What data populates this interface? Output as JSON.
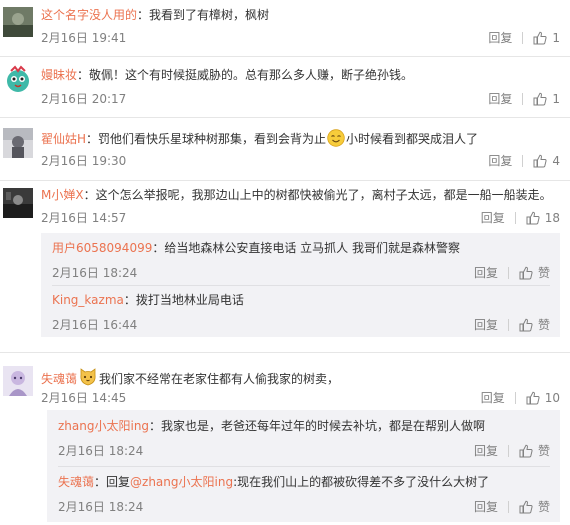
{
  "comments": [
    {
      "username": "这个名字没人用的",
      "text": "：我看到了有樟树，枫树",
      "date": "2月16日 19:41",
      "reply_label": "回复",
      "likes": "1"
    },
    {
      "username": "嫚昧妆",
      "text": "：敬佩！这个有时候挺威胁的。总有那么多人赚，断子绝孙钱。",
      "date": "2月16日 20:17",
      "reply_label": "回复",
      "likes": "1"
    },
    {
      "username": "翟仙姑H",
      "text_before": "：罚他们看快乐星球种树那集，看到会背为止",
      "text_after": "小时候看到都哭成泪人了",
      "date": "2月16日 19:30",
      "reply_label": "回复",
      "likes": "4"
    },
    {
      "username": "M小婵X",
      "text": "：这个怎么举报呢，我那边山上中的树都快被偷光了，离村子太远，都是一船一船装走。",
      "date": "2月16日 14:57",
      "reply_label": "回复",
      "likes": "18",
      "replies": [
        {
          "username": "用户6058094099",
          "text": "：给当地森林公安直接电话 立马抓人 我哥们就是森林警察",
          "date": "2月16日 18:24",
          "reply_label": "回复",
          "like_label": "赞"
        },
        {
          "username": "King_kazma",
          "text": "：拨打当地林业局电话",
          "date": "2月16日 16:44",
          "reply_label": "回复",
          "like_label": "赞"
        }
      ]
    },
    {
      "username": "失魂蔼",
      "text": "我们家不经常在老家住都有人偷我家的树卖，",
      "date": "2月16日 14:45",
      "reply_label": "回复",
      "likes": "10",
      "replies": [
        {
          "username": "zhang小太阳ing",
          "text": "：我家也是，老爸还每年过年的时候去补坑，都是在帮别人做啊",
          "date": "2月16日 18:24",
          "reply_label": "回复",
          "like_label": "赞"
        },
        {
          "username": "失魂蔼",
          "text_prefix": "：回复",
          "mention": "@zhang小太阳ing",
          "text": ":现在我们山上的都被砍得差不多了没什么大树了",
          "date": "2月16日 18:24",
          "reply_label": "回复",
          "like_label": "赞"
        }
      ]
    }
  ],
  "colors": {
    "username": "#eb7350",
    "meta": "#808080",
    "reply_bg": "#f2f2f5"
  },
  "icons": {
    "like": "thumbs-up-icon",
    "reply_like": "thumbs-up-icon",
    "emoji": "smile-emoji-icon",
    "cat_emoji": "cat-emoji-icon"
  }
}
